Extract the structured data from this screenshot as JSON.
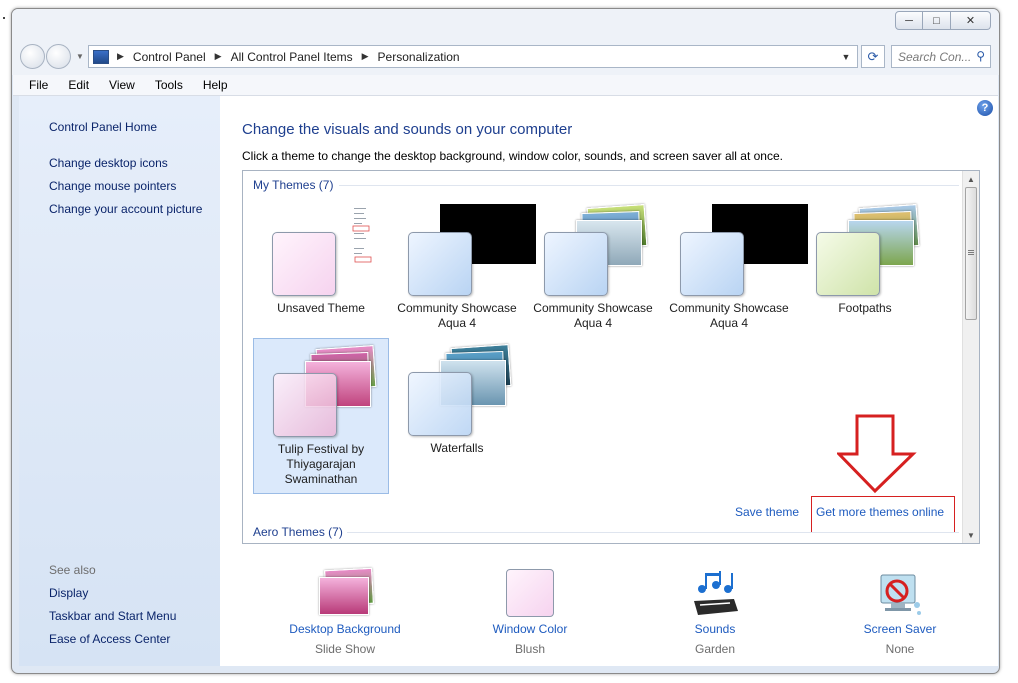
{
  "window": {
    "caption_buttons": {
      "minimize": "─",
      "maximize": "□",
      "close": "✕"
    }
  },
  "address": {
    "breadcrumbs": [
      "Control Panel",
      "All Control Panel Items",
      "Personalization"
    ],
    "search_placeholder": "Search Con..."
  },
  "menu": [
    "File",
    "Edit",
    "View",
    "Tools",
    "Help"
  ],
  "sidebar": {
    "home": "Control Panel Home",
    "links": [
      "Change desktop icons",
      "Change mouse pointers",
      "Change your account picture"
    ],
    "see_also_title": "See also",
    "see_also": [
      "Display",
      "Taskbar and Start Menu",
      "Ease of Access Center"
    ]
  },
  "main": {
    "heading": "Change the visuals and sounds on your computer",
    "instruction": "Click a theme to change the desktop background, window color, sounds, and screen saver all at once.",
    "my_themes_title": "My Themes (7)",
    "aero_themes_title": "Aero Themes (7)",
    "themes": [
      {
        "name": "Unsaved Theme",
        "selected": false
      },
      {
        "name": "Community Showcase Aqua 4",
        "selected": false
      },
      {
        "name": "Community Showcase Aqua 4",
        "selected": false
      },
      {
        "name": "Community Showcase Aqua 4",
        "selected": false
      },
      {
        "name": "Footpaths",
        "selected": false
      },
      {
        "name": "Tulip Festival by Thiyagarajan Swaminathan",
        "selected": true
      },
      {
        "name": "Waterfalls",
        "selected": false
      }
    ],
    "save_theme": "Save theme",
    "get_more_themes": "Get more themes online"
  },
  "bottom": [
    {
      "label": "Desktop Background",
      "sub": "Slide Show",
      "icon": "tulip-photo-icon"
    },
    {
      "label": "Window Color",
      "sub": "Blush",
      "icon": "color-swatch-icon"
    },
    {
      "label": "Sounds",
      "sub": "Garden",
      "icon": "music-notes-icon"
    },
    {
      "label": "Screen Saver",
      "sub": "None",
      "icon": "screen-saver-icon"
    }
  ],
  "colors": {
    "link": "#1e5bbf",
    "heading": "#1e3f8f",
    "sidebar_link": "#0a246a",
    "annotation_red": "#d62020",
    "selection": "#dbe9fb"
  }
}
